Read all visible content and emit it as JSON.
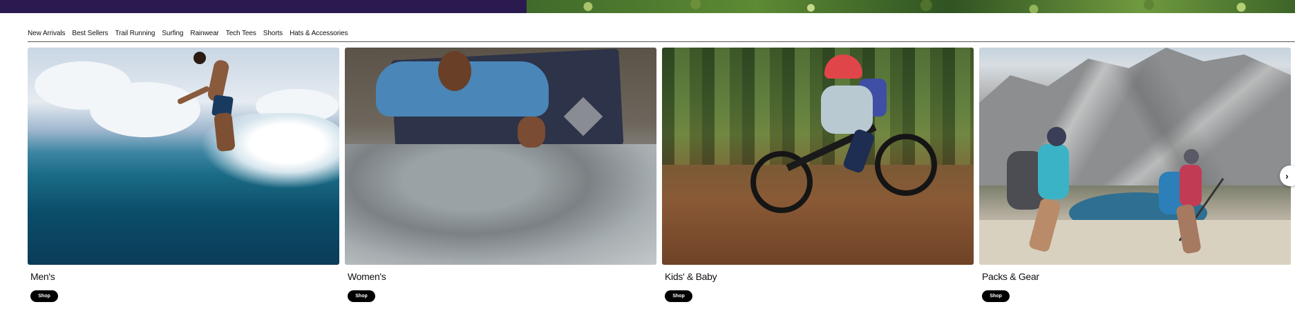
{
  "nav": {
    "items": [
      {
        "label": "New Arrivals"
      },
      {
        "label": "Best Sellers"
      },
      {
        "label": "Trail Running"
      },
      {
        "label": "Surfing"
      },
      {
        "label": "Rainwear"
      },
      {
        "label": "Tech Tees"
      },
      {
        "label": "Shorts"
      },
      {
        "label": "Hats & Accessories"
      }
    ]
  },
  "cards": [
    {
      "title": "Men's",
      "button": "Shop",
      "image": "surfer-photo"
    },
    {
      "title": "Women's",
      "button": "Shop",
      "image": "climber-photo"
    },
    {
      "title": "Kids' & Baby",
      "button": "Shop",
      "image": "kid-biker-photo"
    },
    {
      "title": "Packs & Gear",
      "button": "Shop",
      "image": "hikers-photo"
    }
  ],
  "carousel": {
    "next_icon": "chevron-right-icon",
    "next_glyph": "›"
  },
  "colors": {
    "hero_band": "#2b1a4f",
    "button_bg": "#000000",
    "button_text": "#ffffff"
  }
}
